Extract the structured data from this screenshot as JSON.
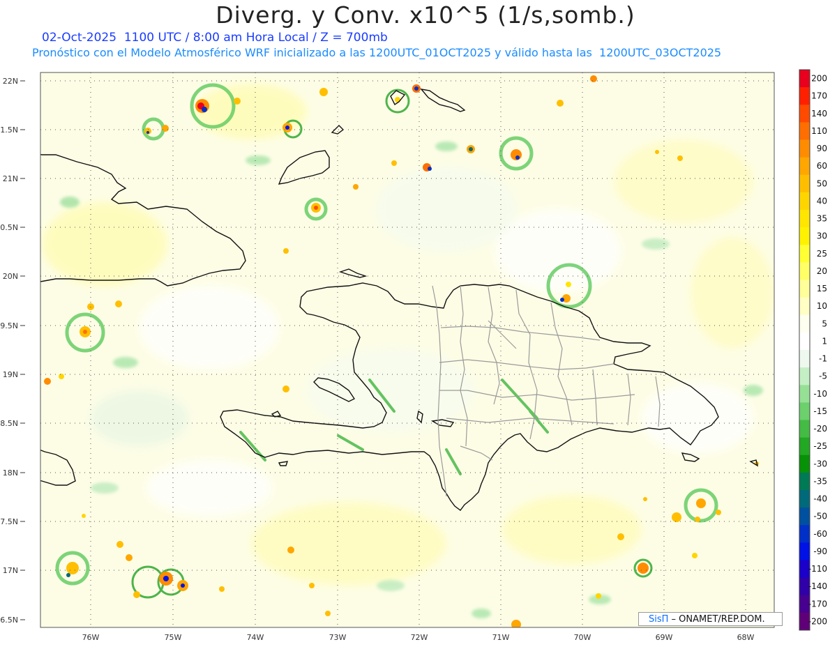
{
  "header": {
    "title": "Diverg. y Conv. x10^5 (1/s,somb.)",
    "line1": "02-Oct-2025  1100 UTC / 8:00 am Hora Local / Z = 700mb",
    "line2": "Pronóstico con el Modelo Atmosférico WRF inicializado a las 1200UTC_01OCT2025 y válido hasta las  1200UTC_03OCT2025"
  },
  "axes": {
    "lat_labels": [
      "22N",
      "1.5N",
      "21N",
      "0.5N",
      "20N",
      "9.5N",
      "19N",
      "8.5N",
      "18N",
      "7.5N",
      "17N",
      "6.5N"
    ],
    "lon_labels": [
      "76W",
      "75W",
      "74W",
      "73W",
      "72W",
      "71W",
      "70W",
      "69W",
      "68W"
    ]
  },
  "colorbar": {
    "labels": [
      "200",
      "170",
      "140",
      "110",
      "90",
      "60",
      "50",
      "40",
      "35",
      "30",
      "25",
      "20",
      "15",
      "10",
      "5",
      "1",
      "-1",
      "-5",
      "-10",
      "-15",
      "-20",
      "-25",
      "-30",
      "-35",
      "-40",
      "-50",
      "-60",
      "-90",
      "-110",
      "-140",
      "-170",
      "-200"
    ],
    "colors": [
      "#e8001e",
      "#ff2000",
      "#ff4a00",
      "#ff6e00",
      "#ff8c00",
      "#ffa600",
      "#ffbf00",
      "#ffd500",
      "#ffe600",
      "#fff200",
      "#ffff33",
      "#ffff66",
      "#ffff99",
      "#ffffc4",
      "#fffff0",
      "#ffffff",
      "#eef8ee",
      "#c4efc4",
      "#96e096",
      "#6cd06c",
      "#44bb44",
      "#22a822",
      "#079107",
      "#007a55",
      "#006a7a",
      "#0050a0",
      "#0030c8",
      "#0012e6",
      "#1a00c8",
      "#3000a8",
      "#480090",
      "#600078"
    ]
  },
  "credit": {
    "brand": "SisΠ",
    "text": " – ONAMET/REP.DOM."
  }
}
